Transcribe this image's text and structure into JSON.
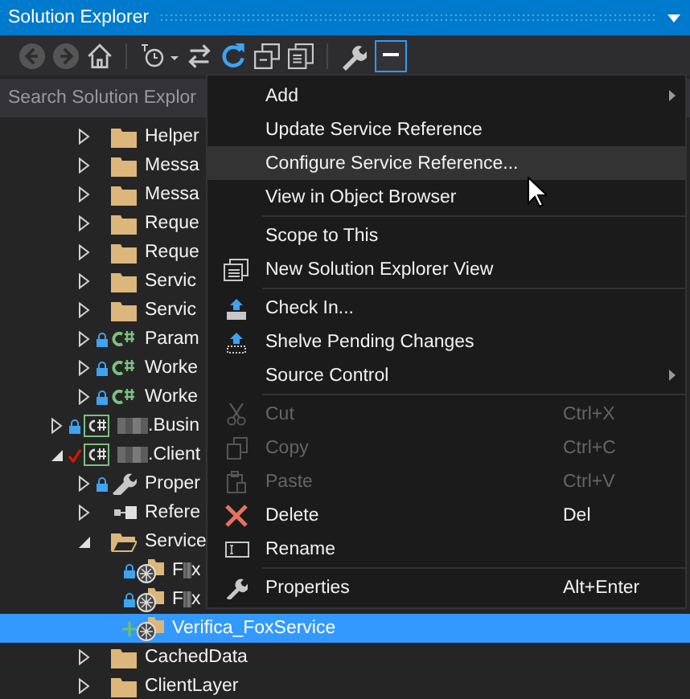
{
  "window": {
    "title": "Solution Explorer"
  },
  "search": {
    "placeholder": "Search Solution Explor"
  },
  "tree": {
    "continued_children": [
      {
        "label": "Helper",
        "kind": "folder",
        "expanded": false,
        "selected": false
      },
      {
        "label": "Messa",
        "kind": "folder",
        "expanded": false,
        "selected": false
      },
      {
        "label": "Messa",
        "kind": "folder",
        "expanded": false,
        "selected": false
      },
      {
        "label": "Reque",
        "kind": "folder",
        "expanded": false,
        "selected": false
      },
      {
        "label": "Reque",
        "kind": "folder",
        "expanded": false,
        "selected": false
      },
      {
        "label": "Servic",
        "kind": "folder",
        "expanded": false,
        "selected": false
      },
      {
        "label": "Servic",
        "kind": "folder",
        "expanded": false,
        "selected": false
      },
      {
        "label": "Param",
        "kind": "csharp",
        "locked": true,
        "expanded": false,
        "selected": false
      },
      {
        "label": "Worke",
        "kind": "csharp",
        "locked": true,
        "expanded": false,
        "selected": false
      },
      {
        "label": "Worke",
        "kind": "csharp",
        "locked": true,
        "expanded": false,
        "selected": false
      }
    ],
    "items": [
      {
        "label": ".Busin",
        "kind": "project",
        "locked": true,
        "redacted": true,
        "expanded": false,
        "selected": false
      },
      {
        "label": ".Client",
        "kind": "project",
        "checked_out": true,
        "redacted": true,
        "expanded": true,
        "selected": false,
        "children": [
          {
            "label": "Proper",
            "kind": "properties",
            "locked": true,
            "expanded": false,
            "selected": false
          },
          {
            "label": "Refere",
            "kind": "references",
            "expanded": false,
            "selected": false
          },
          {
            "label": "Service",
            "kind": "openfolder",
            "expanded": true,
            "selected": false,
            "children": [
              {
                "label": "F",
                "label_end": "x",
                "kind": "servicereference",
                "locked": true,
                "redacted": true,
                "selected": false
              },
              {
                "label": "F",
                "label_end": "x",
                "kind": "servicereference",
                "locked": true,
                "redacted": true,
                "selected": false
              },
              {
                "label": "Verifica_FoxService",
                "kind": "servicereference",
                "pending_add": true,
                "selected": true
              }
            ]
          },
          {
            "label": "CachedData",
            "kind": "folder",
            "expanded": false,
            "selected": false
          },
          {
            "label": "ClientLayer",
            "kind": "folder",
            "expanded": false,
            "selected": false
          }
        ]
      }
    ]
  },
  "context_menu": [
    {
      "kind": "item",
      "label": "Add",
      "submenu": true,
      "disabled": false,
      "selected": false
    },
    {
      "kind": "item",
      "label": "Update Service Reference",
      "disabled": false,
      "selected": false
    },
    {
      "kind": "item",
      "label": "Configure Service Reference...",
      "disabled": false,
      "selected": true
    },
    {
      "kind": "item",
      "label": "View in Object Browser",
      "disabled": false,
      "selected": false
    },
    {
      "kind": "separator"
    },
    {
      "kind": "item",
      "label": "Scope to This",
      "disabled": false,
      "selected": false
    },
    {
      "kind": "newview",
      "label": "New Solution Explorer View",
      "disabled": false,
      "selected": false
    },
    {
      "kind": "separator"
    },
    {
      "kind": "checkin",
      "label": "Check In...",
      "disabled": false,
      "selected": false
    },
    {
      "kind": "shelve",
      "label": "Shelve Pending Changes",
      "disabled": false,
      "selected": false
    },
    {
      "kind": "item",
      "label": "Source Control",
      "submenu": true,
      "disabled": false,
      "selected": false
    },
    {
      "kind": "separator"
    },
    {
      "kind": "cut",
      "label": "Cut",
      "shortcut": "Ctrl+X",
      "disabled": true,
      "selected": false
    },
    {
      "kind": "copy",
      "label": "Copy",
      "shortcut": "Ctrl+C",
      "disabled": true,
      "selected": false
    },
    {
      "kind": "paste",
      "label": "Paste",
      "shortcut": "Ctrl+V",
      "disabled": true,
      "selected": false
    },
    {
      "kind": "delete",
      "label": "Delete",
      "shortcut": "Del",
      "disabled": false,
      "selected": false
    },
    {
      "kind": "rename",
      "label": "Rename",
      "disabled": false,
      "selected": false
    },
    {
      "kind": "separator"
    },
    {
      "kind": "properties",
      "label": "Properties",
      "shortcut": "Alt+Enter",
      "disabled": false,
      "selected": false
    }
  ]
}
